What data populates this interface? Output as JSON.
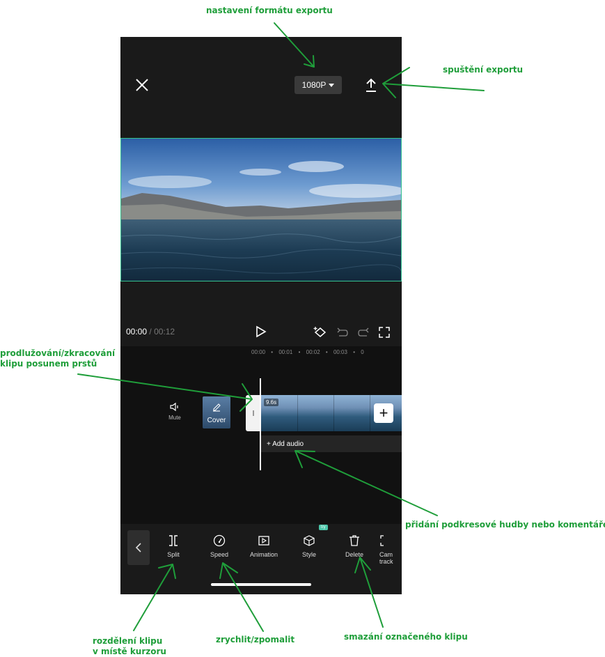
{
  "annotations": {
    "export_format": "nastavení formátu exportu",
    "export_start": "spuštění exportu",
    "trim_line1": "prodlužování/zkracování",
    "trim_line2": "klipu posunem prstů",
    "add_audio_note": "přidání podkresové hudby nebo komentáře",
    "split_line1": "rozdělení klipu",
    "split_line2": "v místě kurzoru",
    "speed_note": "zrychlit/zpomalit",
    "delete_note": "smazání označeného klipu"
  },
  "top_bar": {
    "close_icon": "close-icon",
    "resolution": "1080P",
    "export_icon": "upload-icon"
  },
  "transport": {
    "current_time": "00:00",
    "separator": "/",
    "total_time": "00:12"
  },
  "timeline": {
    "ruler": [
      "00:00",
      "•",
      "00:01",
      "•",
      "00:02",
      "•",
      "00:03",
      "•",
      "0"
    ],
    "mute_label": "Mute",
    "cover_label": "Cover",
    "clip_duration": "9.6s",
    "add_audio": "+ Add audio"
  },
  "toolbar": {
    "items": [
      {
        "label": "Split",
        "icon": "split-icon"
      },
      {
        "label": "Speed",
        "icon": "speed-icon"
      },
      {
        "label": "Animation",
        "icon": "animation-icon"
      },
      {
        "label": "Style",
        "icon": "style-icon",
        "badge": "try"
      },
      {
        "label": "Delete",
        "icon": "delete-icon"
      },
      {
        "label": "Cam",
        "label2": "track",
        "icon": "camera-tracking-icon"
      }
    ]
  },
  "colors": {
    "annotation": "#1f9e3a",
    "preview_border": "#35c28f",
    "background": "#1a1a1a"
  }
}
